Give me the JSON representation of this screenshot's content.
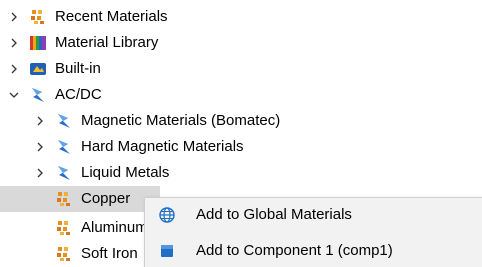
{
  "tree": {
    "items": [
      {
        "label": "Recent Materials",
        "icon": "recent-materials-icon",
        "expanded": false
      },
      {
        "label": "Material Library",
        "icon": "material-library-icon",
        "expanded": false
      },
      {
        "label": "Built-in",
        "icon": "built-in-icon",
        "expanded": false
      },
      {
        "label": "AC/DC",
        "icon": "acdc-icon",
        "expanded": true
      },
      {
        "label": "Magnetic Materials (Bomatec)",
        "icon": "acdc-icon",
        "expanded": false
      },
      {
        "label": "Hard Magnetic Materials",
        "icon": "acdc-icon",
        "expanded": false
      },
      {
        "label": "Liquid Metals",
        "icon": "acdc-icon",
        "expanded": false
      },
      {
        "label": "Copper",
        "icon": "material-icon",
        "selected": true
      },
      {
        "label": "Aluminum",
        "icon": "material-icon"
      },
      {
        "label": "Soft Iron",
        "icon": "material-icon"
      }
    ]
  },
  "context_menu": {
    "items": [
      {
        "label": "Add to Global Materials",
        "icon": "globe-icon"
      },
      {
        "label": "Add to Component 1 (comp1)",
        "icon": "component-cube-icon"
      }
    ]
  },
  "colors": {
    "selection": "#d9d9d9",
    "menu_background": "#f2f2f2",
    "material_orange": "#e8901c",
    "acdc_blue": "#2a6cc7",
    "globe_blue": "#1f6fc5"
  }
}
